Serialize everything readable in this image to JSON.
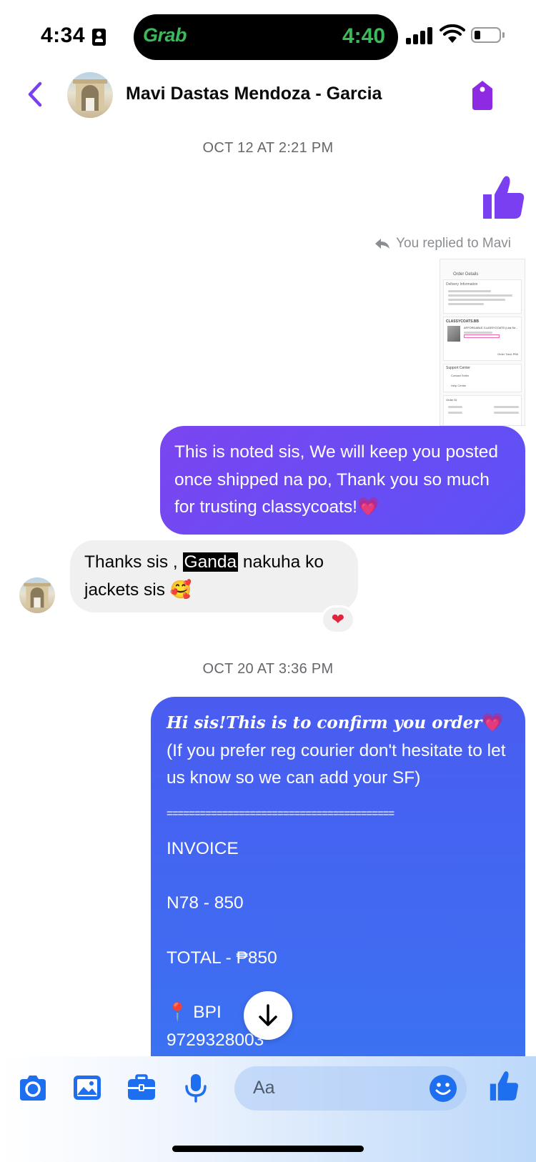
{
  "status_bar": {
    "time": "4:34",
    "island_app": "Grab",
    "island_time": "4:40"
  },
  "header": {
    "contact_name": "Mavi Dastas Mendoza - Garcia"
  },
  "messages": {
    "timestamp_1": "OCT 12 AT 2:21 PM",
    "reply_note": "You replied to Mavi",
    "screenshot": {
      "title": "Order Details",
      "section": "Delivery Information",
      "shop": "CLASSYCOATS.BB",
      "product": "AFFORDABLE CLASSYCOATS (Lira Se...",
      "order_total": "Order Total: ₱56",
      "support": "Support Center",
      "contact_seller": "Contact Seller",
      "help_center": "Help Center",
      "order_id_label": "Order ID"
    },
    "out_1": "This is noted sis, We will keep you posted once shipped na po, Thank you so much for trusting classycoats!💗",
    "in_1_before": "Thanks sis , ",
    "in_1_highlight": "Ganda",
    "in_1_after": " nakuha ko jackets sis 🥰",
    "in_1_reaction": "❤",
    "timestamp_2": "OCT 20 AT 3:36 PM",
    "out_2": {
      "greeting": "Hi sis!",
      "confirm": "This is to confirm you order",
      "heart": "💗",
      "note": "(If you prefer reg courier don't hesitate to let us know so we can add your SF)",
      "separator": "=========================================",
      "invoice": "INVOICE",
      "item": "N78 - 850",
      "total": "TOTAL - ₱850",
      "bank": "📍 BPI",
      "account": "9729328003"
    }
  },
  "composer": {
    "placeholder": "Aa"
  },
  "colors": {
    "accent_purple": "#7b3ff2",
    "messenger_blue": "#1e6ff0",
    "out_bubble_1": "#6a4cf3",
    "out_bubble_2": "#3f66f1",
    "in_bubble": "#f0f0f0"
  }
}
